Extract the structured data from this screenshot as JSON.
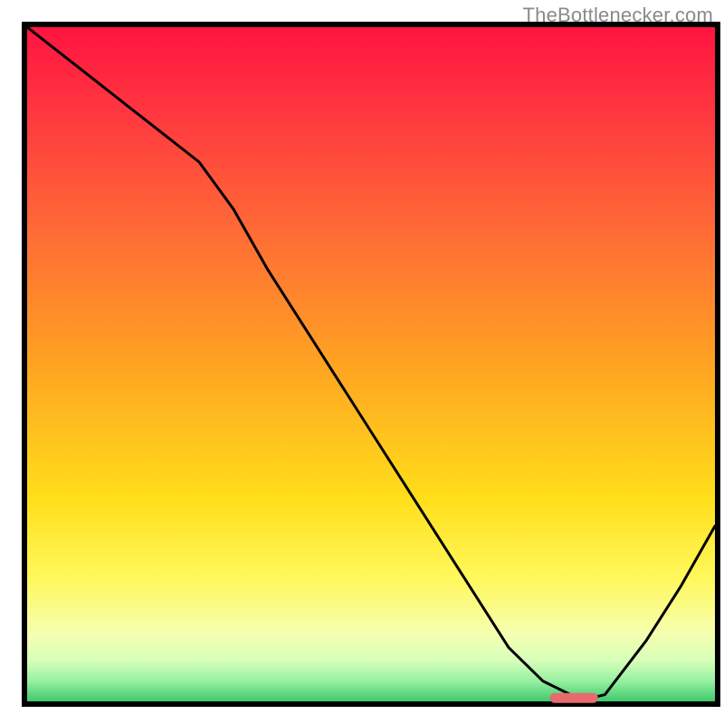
{
  "watermark": "TheBottlenecker.com",
  "chart_data": {
    "type": "line",
    "description": "Bottleneck-style V-curve over a vertical rainbow gradient background (red→orange→yellow→green) with a short red marker segment at the trough",
    "x": [
      0,
      5,
      10,
      15,
      20,
      25,
      30,
      35,
      40,
      45,
      50,
      55,
      60,
      65,
      70,
      75,
      80,
      82,
      84,
      90,
      95,
      100
    ],
    "y": [
      100,
      96,
      92,
      88,
      84,
      80,
      73,
      64,
      56,
      48,
      40,
      32,
      24,
      16,
      8,
      3,
      0.5,
      0.5,
      1,
      9,
      17,
      26
    ],
    "xlim": [
      0,
      100
    ],
    "ylim": [
      0,
      100
    ],
    "xlabel": "",
    "ylabel": "",
    "title": "",
    "marker": {
      "x0": 76,
      "x1": 83,
      "y": 0.5,
      "color": "#e76a6f"
    },
    "background_gradient": [
      {
        "stop": 0.0,
        "color": "#ff1440"
      },
      {
        "stop": 0.12,
        "color": "#ff3540"
      },
      {
        "stop": 0.3,
        "color": "#ff6a36"
      },
      {
        "stop": 0.5,
        "color": "#ffa322"
      },
      {
        "stop": 0.7,
        "color": "#ffdf1a"
      },
      {
        "stop": 0.82,
        "color": "#fff85e"
      },
      {
        "stop": 0.9,
        "color": "#f6ffb0"
      },
      {
        "stop": 0.94,
        "color": "#d6ffba"
      },
      {
        "stop": 0.97,
        "color": "#96f0a0"
      },
      {
        "stop": 1.0,
        "color": "#3ec96b"
      }
    ],
    "frame_color": "#000000",
    "curve_color": "#000000"
  }
}
